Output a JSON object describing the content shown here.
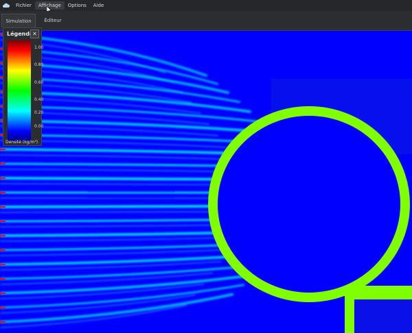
{
  "menubar": {
    "icon": "cloud-icon",
    "items": [
      {
        "label": "Fichier"
      },
      {
        "label": "Affichage"
      },
      {
        "label": "Options"
      },
      {
        "label": "Aide"
      }
    ]
  },
  "tabs": [
    {
      "label": "Simulation"
    },
    {
      "label": "Éditeur"
    }
  ],
  "legend": {
    "title": "Légende",
    "close_icon": "close-icon",
    "ticks": [
      "1.00",
      "0.80",
      "0.60",
      "0.40",
      "0.20",
      "0.00"
    ],
    "unit": "Densité (kg/m³)"
  },
  "colors": {
    "field_background": "#0000ff",
    "obstacle": "#80ff00",
    "wave_peak": "#00ffff",
    "source": "#ff0000"
  }
}
